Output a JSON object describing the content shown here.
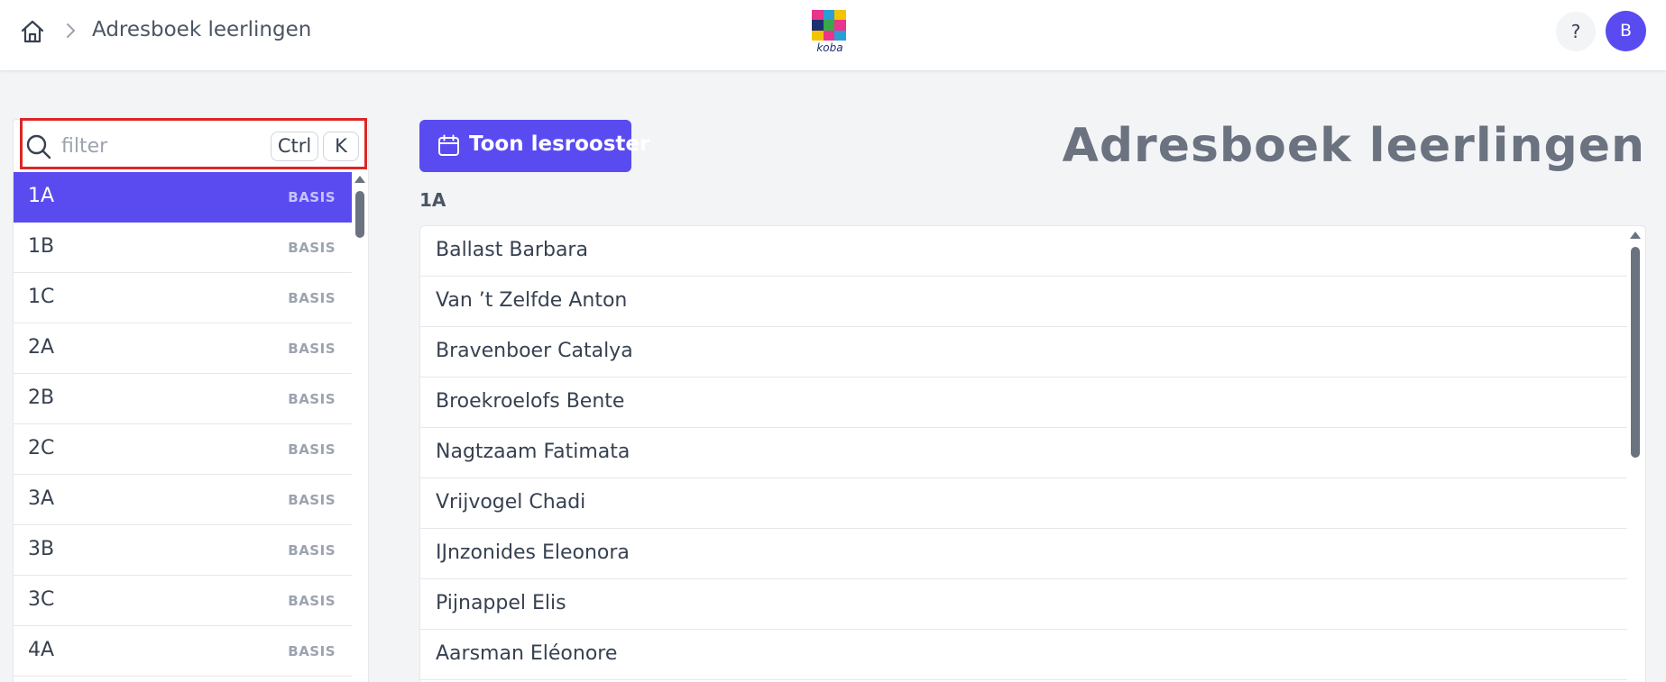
{
  "header": {
    "breadcrumb": "Adresboek leerlingen",
    "help_label": "?",
    "avatar_initial": "B",
    "logo_text": "koba"
  },
  "filter": {
    "placeholder": "filter",
    "shortcut_keys": [
      "Ctrl",
      "K"
    ]
  },
  "classes": [
    {
      "name": "1A",
      "tag": "BASIS",
      "selected": true
    },
    {
      "name": "1B",
      "tag": "BASIS"
    },
    {
      "name": "1C",
      "tag": "BASIS"
    },
    {
      "name": "2A",
      "tag": "BASIS"
    },
    {
      "name": "2B",
      "tag": "BASIS"
    },
    {
      "name": "2C",
      "tag": "BASIS"
    },
    {
      "name": "3A",
      "tag": "BASIS"
    },
    {
      "name": "3B",
      "tag": "BASIS"
    },
    {
      "name": "3C",
      "tag": "BASIS"
    },
    {
      "name": "4A",
      "tag": "BASIS"
    }
  ],
  "main": {
    "schedule_button_label": "Toon lesrooster",
    "page_title": "Adresboek leerlingen",
    "selected_class_label": "1A"
  },
  "students": [
    "Ballast Barbara",
    "Van ’t Zelfde Anton",
    "Bravenboer Catalya",
    "Broekroelofs Bente",
    "Nagtzaam Fatimata",
    "Vrijvogel Chadi",
    "IJnzonides Eleonora",
    "Pijnappel Elis",
    "Aarsman Eléonore"
  ],
  "colors": {
    "accent": "#5a4bf1",
    "highlight_border": "#dc2626",
    "title_gray": "#6b7280"
  }
}
